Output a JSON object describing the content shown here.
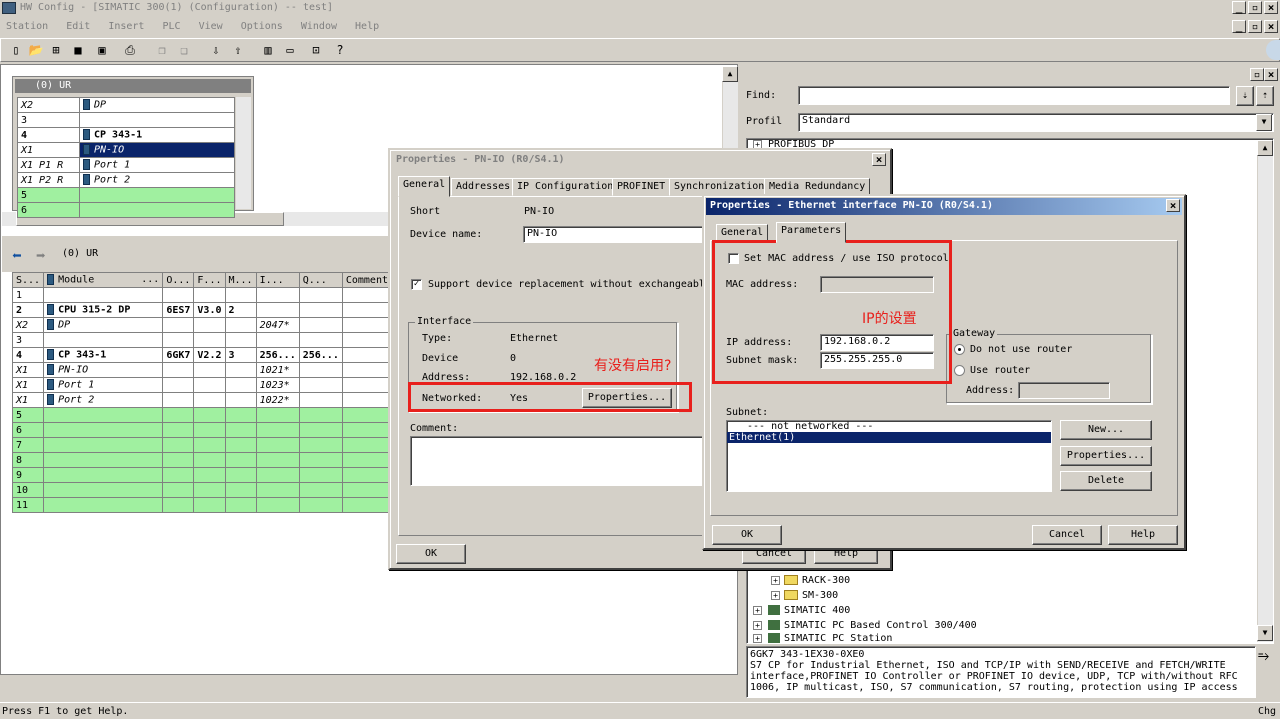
{
  "app": {
    "title": "HW Config - [SIMATIC 300(1) (Configuration) -- test]",
    "menu": [
      "Station",
      "Edit",
      "Insert",
      "PLC",
      "View",
      "Options",
      "Window",
      "Help"
    ],
    "status": "Press F1 to get Help.",
    "status_right": "Chg"
  },
  "rack_top": {
    "title": "(0) UR",
    "rows": [
      {
        "slot": "X2",
        "module": "DP"
      },
      {
        "slot": "3",
        "module": ""
      },
      {
        "slot": "4",
        "module": "CP 343-1"
      },
      {
        "slot": "X1",
        "module": "PN-IO"
      },
      {
        "slot": "X1 P1 R",
        "module": "Port 1"
      },
      {
        "slot": "X1 P2 R",
        "module": "Port 2"
      },
      {
        "slot": "5",
        "module": ""
      },
      {
        "slot": "6",
        "module": ""
      }
    ]
  },
  "rack_detail": {
    "title": "(0)    UR",
    "headers": [
      "S...",
      "Module",
      "...",
      "O...",
      "F...",
      "M...",
      "I...",
      "Q...",
      "Comment"
    ],
    "rows": [
      {
        "s": "1",
        "module": "",
        "o": "",
        "f": "",
        "m": "",
        "i": "",
        "q": ""
      },
      {
        "s": "2",
        "module": "CPU 315-2 DP",
        "o": "6ES7",
        "f": "V3.0",
        "m": "2",
        "i": "",
        "q": ""
      },
      {
        "s": "X2",
        "module": "DP",
        "o": "",
        "f": "",
        "m": "",
        "i": "2047*",
        "q": ""
      },
      {
        "s": "3",
        "module": "",
        "o": "",
        "f": "",
        "m": "",
        "i": "",
        "q": ""
      },
      {
        "s": "4",
        "module": "CP 343-1",
        "o": "6GK7",
        "f": "V2.2",
        "m": "3",
        "i": "256...",
        "q": "256..."
      },
      {
        "s": "X1",
        "module": "PN-IO",
        "o": "",
        "f": "",
        "m": "",
        "i": "1021*",
        "q": ""
      },
      {
        "s": "X1",
        "module": "Port 1",
        "o": "",
        "f": "",
        "m": "",
        "i": "1023*",
        "q": ""
      },
      {
        "s": "X1",
        "module": "Port 2",
        "o": "",
        "f": "",
        "m": "",
        "i": "1022*",
        "q": ""
      },
      {
        "s": "5",
        "module": "",
        "o": "",
        "f": "",
        "m": "",
        "i": "",
        "q": ""
      },
      {
        "s": "6",
        "module": "",
        "o": "",
        "f": "",
        "m": "",
        "i": "",
        "q": ""
      },
      {
        "s": "7",
        "module": "",
        "o": "",
        "f": "",
        "m": "",
        "i": "",
        "q": ""
      },
      {
        "s": "8",
        "module": "",
        "o": "",
        "f": "",
        "m": "",
        "i": "",
        "q": ""
      },
      {
        "s": "9",
        "module": "",
        "o": "",
        "f": "",
        "m": "",
        "i": "",
        "q": ""
      },
      {
        "s": "10",
        "module": "",
        "o": "",
        "f": "",
        "m": "",
        "i": "",
        "q": ""
      },
      {
        "s": "11",
        "module": "",
        "o": "",
        "f": "",
        "m": "",
        "i": "",
        "q": ""
      }
    ]
  },
  "catalog": {
    "find_label": "Find:",
    "find_value": "",
    "profile_label": "Profil",
    "profile_value": "Standard",
    "tree_top": "PROFIBUS DP",
    "tree": [
      {
        "label": "RACK-300",
        "type": "folder"
      },
      {
        "label": "SM-300",
        "type": "folder"
      },
      {
        "label": "SIMATIC 400",
        "type": "station"
      },
      {
        "label": "SIMATIC PC Based Control 300/400",
        "type": "station"
      },
      {
        "label": "SIMATIC PC Station",
        "type": "station"
      }
    ],
    "info_lines": [
      "6GK7 343-1EX30-0XE0",
      "S7 CP for Industrial Ethernet, ISO and TCP/IP with SEND/RECEIVE and FETCH/WRITE",
      "interface,PROFINET IO Controller or PROFINET IO device, UDP, TCP with/without RFC",
      "1006, IP multicast, ISO, S7 communication, S7 routing, protection using IP access"
    ]
  },
  "dialog1": {
    "title": "Properties - PN-IO (R0/S4.1)",
    "tabs": [
      "General",
      "Addresses",
      "IP Configuration",
      "PROFINET",
      "Synchronization",
      "Media Redundancy"
    ],
    "short_label": "Short",
    "short_value": "PN-IO",
    "device_name_label": "Device name:",
    "device_name_value": "PN-IO",
    "support_label": "Support device replacement without exchangeable m",
    "interface_group": "Interface",
    "type_label": "Type:",
    "type_value": "Ethernet",
    "device_label": "Device",
    "device_value": "0",
    "address_label": "Address:",
    "address_value": "192.168.0.2",
    "networked_label": "Networked:",
    "networked_value": "Yes",
    "properties_btn": "Properties...",
    "comment_label": "Comment:",
    "ok": "OK",
    "cancel": "Cancel",
    "help": "Help"
  },
  "dialog2": {
    "title": "Properties - Ethernet interface  PN-IO (R0/S4.1)",
    "tabs": [
      "General",
      "Parameters"
    ],
    "mac_check_label": "Set MAC address / use ISO protocol",
    "mac_label": "MAC address:",
    "ip_label": "IP address:",
    "ip_value": "192.168.0.2",
    "subnet_label": "Subnet mask:",
    "subnet_value": "255.255.255.0",
    "gateway_group": "Gateway",
    "no_router": "Do not use router",
    "use_router": "Use router",
    "gw_address_label": "Address:",
    "subnet_list_label": "Subnet:",
    "subnets": [
      "--- not networked ---",
      "Ethernet(1)"
    ],
    "new_btn": "New...",
    "props_btn": "Properties...",
    "delete_btn": "Delete",
    "ok": "OK",
    "cancel": "Cancel",
    "help": "Help"
  },
  "annotations": {
    "ip_setting": "IP的设置",
    "enabled_q": "有没有启用?"
  },
  "colors": {
    "accent": "#0a246a",
    "highlight": "#e8201c",
    "empty_slot": "#a0f0a0"
  }
}
